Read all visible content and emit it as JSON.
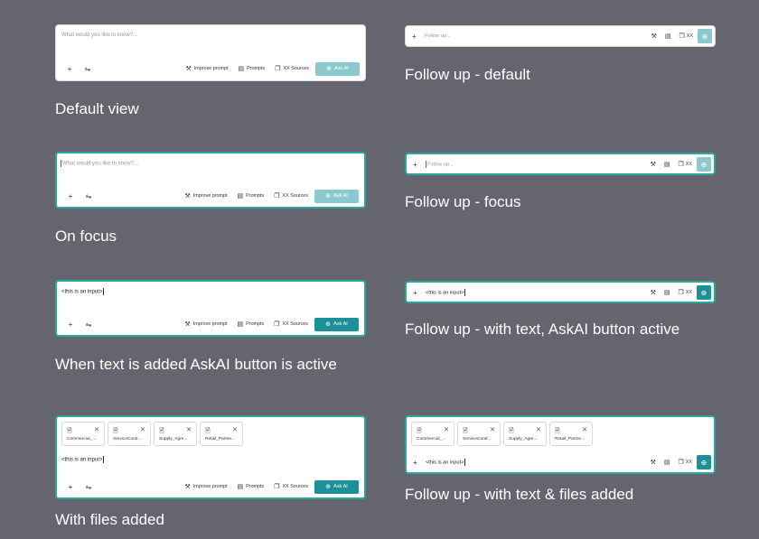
{
  "main_input": {
    "placeholder": "What would you like to know?...",
    "typed_text": "<this is an input>",
    "plus_icon": "+",
    "settings_icon": "⇋",
    "improve_prompt": "Improve prompt",
    "prompts": "Prompts",
    "sources": "XX Sources",
    "ask_ai": "Ask AI"
  },
  "follow_up": {
    "placeholder": "Follow up...",
    "typed_text": "<this is an input>",
    "plus_icon": "+",
    "sources_count": "XX"
  },
  "files": [
    {
      "name": "Commercial_..."
    },
    {
      "name": "ServiceContr..."
    },
    {
      "name": "Supply_Agre..."
    },
    {
      "name": "Retail_Partne..."
    }
  ],
  "labels": {
    "default_view": "Default view",
    "on_focus": "On focus",
    "text_added": "When text is added AskAI button is active",
    "files_added": "With files added",
    "follow_default": "Follow up - default",
    "follow_focus": "Follow up - focus",
    "follow_text": "Follow up - with text, AskAI button active",
    "follow_text_files": "Follow up - with text & files added"
  },
  "colors": {
    "background": "#65656f",
    "accent_active": "#1c8f98",
    "accent_inactive": "#8cc9cf",
    "focus_border": "#2aa79b"
  },
  "icons": {
    "improve": "wand-icon",
    "prompts": "prompts-icon",
    "sources": "sources-icon",
    "ask": "ask-ai-icon",
    "file": "file-icon",
    "remove": "close-icon"
  }
}
